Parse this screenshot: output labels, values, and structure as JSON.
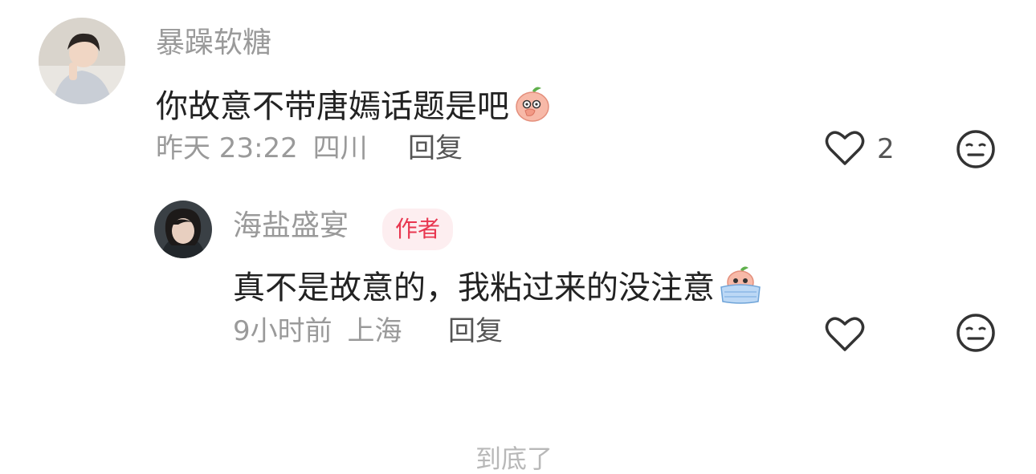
{
  "comments": [
    {
      "username": "暴躁软糖",
      "text": "你故意不带唐嫣话题是吧",
      "emoji": "peach-covering-mouth-emoji",
      "time": "昨天 23:22",
      "location": "四川",
      "reply_label": "回复",
      "like_count": "2"
    },
    {
      "username": "海盐盛宴",
      "author_badge": "作者",
      "text": "真不是故意的，我粘过来的没注意",
      "emoji": "peach-crying-emoji",
      "time": "9小时前",
      "location": "上海",
      "reply_label": "回复"
    }
  ],
  "footer": {
    "end_text": "到底了"
  },
  "icons": {
    "like": "heart-outline-icon",
    "dislike": "neutral-face-icon"
  },
  "colors": {
    "badge_text": "#e8364f",
    "badge_bg": "#fdeef0",
    "muted": "#9a9a9a",
    "content": "#222222"
  }
}
